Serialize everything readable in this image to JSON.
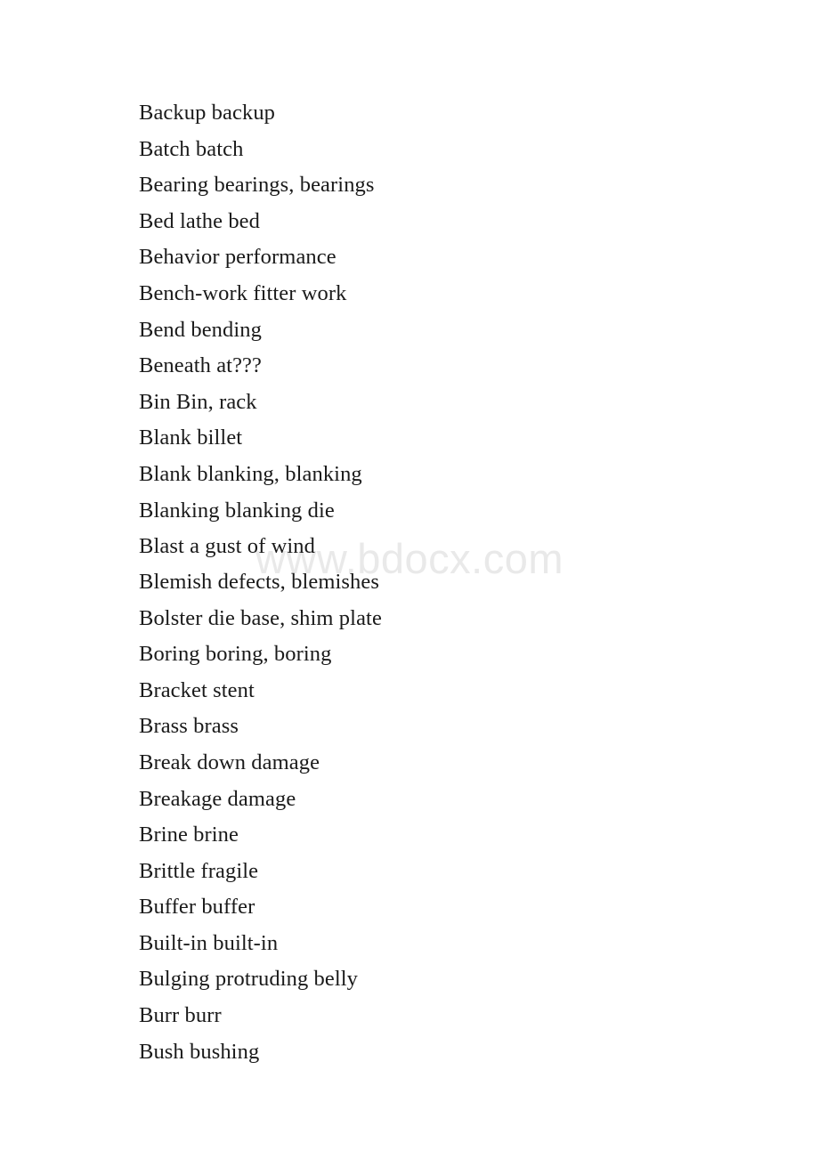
{
  "document": {
    "watermark": "www.bdocx.com",
    "watermark_color": "#e9e9e9",
    "text_color": "#1a1a1a",
    "background_color": "#ffffff",
    "entries": [
      {
        "term": "Backup",
        "gloss": "backup",
        "line": "Backup backup"
      },
      {
        "term": "Batch",
        "gloss": "batch",
        "line": "Batch batch"
      },
      {
        "term": "Bearing",
        "gloss": "bearings, bearings",
        "line": "Bearing bearings, bearings"
      },
      {
        "term": "Bed",
        "gloss": "lathe bed",
        "line": "Bed lathe bed"
      },
      {
        "term": "Behavior",
        "gloss": "performance",
        "line": "Behavior performance"
      },
      {
        "term": "Bench-work",
        "gloss": "fitter work",
        "line": "Bench-work fitter work"
      },
      {
        "term": "Bend",
        "gloss": "bending",
        "line": "Bend bending"
      },
      {
        "term": "Beneath",
        "gloss": "at???",
        "line": "Beneath at???"
      },
      {
        "term": "Bin",
        "gloss": "Bin, rack",
        "line": "Bin Bin, rack"
      },
      {
        "term": "Blank",
        "gloss": "billet",
        "line": "Blank billet"
      },
      {
        "term": "Blank",
        "gloss": "blanking, blanking",
        "line": "Blank blanking, blanking"
      },
      {
        "term": "Blanking",
        "gloss": "blanking die",
        "line": "Blanking blanking die"
      },
      {
        "term": "Blast",
        "gloss": "a gust of wind",
        "line": "Blast a gust of wind"
      },
      {
        "term": "Blemish",
        "gloss": "defects, blemishes",
        "line": "Blemish defects, blemishes"
      },
      {
        "term": "Bolster",
        "gloss": "die base, shim plate",
        "line": "Bolster die base, shim plate"
      },
      {
        "term": "Boring",
        "gloss": "boring, boring",
        "line": "Boring boring, boring"
      },
      {
        "term": "Bracket",
        "gloss": "stent",
        "line": "Bracket stent"
      },
      {
        "term": "Brass",
        "gloss": "brass",
        "line": "Brass brass"
      },
      {
        "term": "Break down",
        "gloss": "damage",
        "line": "Break down damage"
      },
      {
        "term": "Breakage",
        "gloss": "damage",
        "line": "Breakage damage"
      },
      {
        "term": "Brine",
        "gloss": "brine",
        "line": "Brine brine"
      },
      {
        "term": "Brittle",
        "gloss": "fragile",
        "line": "Brittle fragile"
      },
      {
        "term": "Buffer",
        "gloss": "buffer",
        "line": "Buffer buffer"
      },
      {
        "term": "Built-in",
        "gloss": "built-in",
        "line": "Built-in built-in"
      },
      {
        "term": "Bulging",
        "gloss": "protruding belly",
        "line": "Bulging protruding belly"
      },
      {
        "term": "Burr",
        "gloss": "burr",
        "line": "Burr burr"
      },
      {
        "term": "Bush",
        "gloss": "bushing",
        "line": "Bush bushing"
      }
    ]
  }
}
